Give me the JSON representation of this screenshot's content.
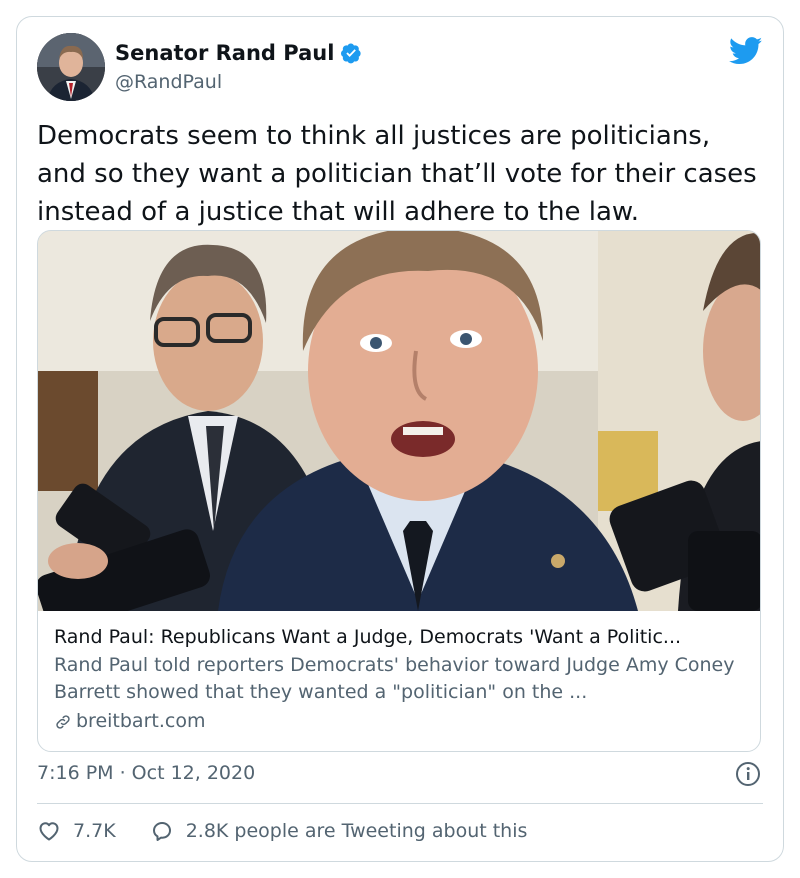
{
  "author": {
    "name": "Senator Rand Paul",
    "handle": "@RandPaul",
    "verified": true
  },
  "tweet": {
    "text": "Democrats seem to think all justices are politicians, and so they want a politician that’ll vote for their cases instead of a justice that will adhere to the law."
  },
  "link_card": {
    "title": "Rand Paul: Republicans Want a Judge, Democrats 'Want a Politic...",
    "description": "Rand Paul told reporters Democrats' behavior toward Judge Amy Coney Barrett showed that they wanted a \"politician\" on the ...",
    "domain": "breitbart.com"
  },
  "meta": {
    "timestamp": "7:16 PM · Oct 12, 2020"
  },
  "actions": {
    "likes": "7.7K",
    "replies_label": "2.8K people are Tweeting about this"
  },
  "colors": {
    "twitter_blue": "#1d9bf0",
    "secondary_text": "#536471",
    "border": "#cfd9de"
  },
  "icons": [
    "verified-badge-icon",
    "twitter-bird-icon",
    "link-icon",
    "info-icon",
    "heart-icon",
    "reply-bubble-icon"
  ]
}
